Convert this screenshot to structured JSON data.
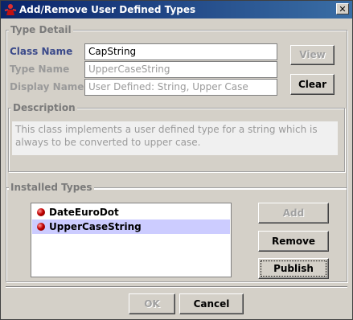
{
  "window": {
    "title": "Add/Remove User Defined Types",
    "close_glyph": "✕"
  },
  "type_detail": {
    "group_title": "Type Detail",
    "class_name_label": "Class Name",
    "class_name_value": "CapString",
    "type_name_label": "Type Name",
    "type_name_value": "UpperCaseString",
    "display_name_label": "Display Name",
    "display_name_value": "User Defined: String,  Upper Case",
    "view_label": "View",
    "clear_label": "Clear"
  },
  "description": {
    "group_title": "Description",
    "text_line1": "This class implements a user defined type for a string which is",
    "text_line2": "always to be converted to upper case."
  },
  "installed_types": {
    "group_title": "Installed Types",
    "items": [
      {
        "label": "DateEuroDot",
        "selected": false
      },
      {
        "label": "UpperCaseString",
        "selected": true
      }
    ],
    "add_label": "Add",
    "remove_label": "Remove",
    "publish_label": "Publish"
  },
  "footer": {
    "ok_label": "OK",
    "cancel_label": "Cancel"
  },
  "icons": {
    "app_icon": "red-figure-icon",
    "bullet_icon": "red-ball-icon"
  }
}
